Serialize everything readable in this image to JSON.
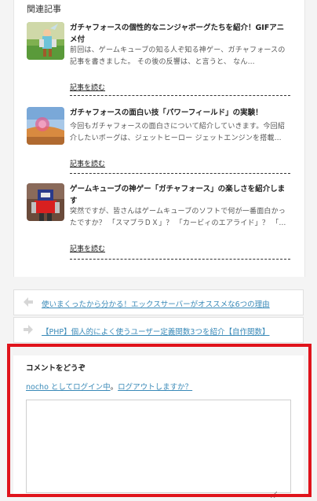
{
  "related": {
    "heading": "関連記事",
    "items": [
      {
        "title": "ガチャフォースの個性的なニンジャボーグたちを紹介！GIFアニメ付",
        "excerpt": "前回は、ゲームキューブの知る人ぞ知る神ゲー、ガチャフォースの記事を書きました。 その後の反響は、と言うと、 なん…",
        "read_more": "記事を読む"
      },
      {
        "title": "ガチャフォースの面白い技「パワーフィールド」の実験！",
        "excerpt": "今回もガチャフォースの面白さについて紹介していきます。今回紹介したいボーグは、ジェットヒーロー ジェットエンジンを搭載…",
        "read_more": "記事を読む"
      },
      {
        "title": "ゲームキューブの神ゲー「ガチャフォース」の楽しさを紹介します",
        "excerpt": "突然ですが、皆さんはゲームキューブのソフトで何が一番面白かったですか？ 「スマブラＤＸ」？ 「カービィのエアライド」？ 「…",
        "read_more": "記事を読む"
      }
    ]
  },
  "post_nav": {
    "prev_label": "使いまくったから分かる！エックスサーバーがオススメな6つの理由",
    "next_label": "【PHP】個人的によく使うユーザー定義関数3つを紹介【自作関数】"
  },
  "comment": {
    "heading": "コメントをどうぞ",
    "logged_in_as": "nocho としてログイン中",
    "separator": "。",
    "logout_label": "ログアウトしますか？",
    "textarea_value": ""
  },
  "colors": {
    "link": "#3a8ab8",
    "highlight_frame": "#e0141c"
  }
}
